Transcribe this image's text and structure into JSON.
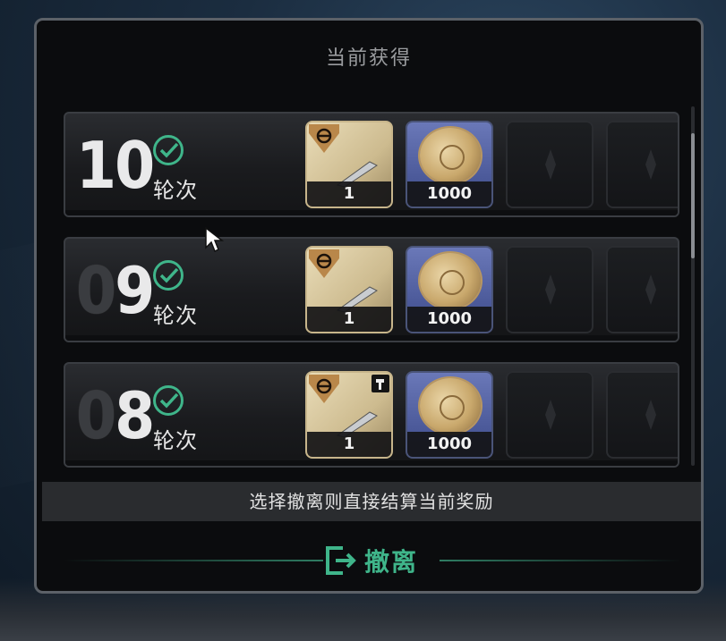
{
  "panel": {
    "title": "当前获得",
    "rows": [
      {
        "round": "10",
        "round_digits": [
          {
            "d": "1",
            "bright": true
          },
          {
            "d": "0",
            "bright": true
          }
        ],
        "label": "轮次",
        "items": [
          {
            "type": "gold",
            "count": "1"
          },
          {
            "type": "coin",
            "count": "1000"
          },
          {
            "type": "empty"
          },
          {
            "type": "empty"
          }
        ]
      },
      {
        "round": "09",
        "round_digits": [
          {
            "d": "0",
            "bright": false
          },
          {
            "d": "9",
            "bright": true
          }
        ],
        "label": "轮次",
        "items": [
          {
            "type": "gold",
            "count": "1"
          },
          {
            "type": "coin",
            "count": "1000"
          },
          {
            "type": "empty"
          },
          {
            "type": "empty"
          }
        ]
      },
      {
        "round": "08",
        "round_digits": [
          {
            "d": "0",
            "bright": false
          },
          {
            "d": "8",
            "bright": true
          }
        ],
        "label": "轮次",
        "items": [
          {
            "type": "gold-tool",
            "count": "1"
          },
          {
            "type": "coin",
            "count": "1000"
          },
          {
            "type": "empty"
          },
          {
            "type": "empty"
          }
        ]
      }
    ],
    "footer_message": "选择撤离则直接结算当前奖励",
    "leave_button_label": "撤离"
  },
  "colors": {
    "accent": "#3fb58a",
    "panel_bg": "#0b0c0e",
    "frame": "#5c6168"
  },
  "icons": {
    "check": "check-circle-icon",
    "leave": "exit-door-icon",
    "empty_slot": "diamond-emblem-icon",
    "tool": "hammer-icon"
  }
}
